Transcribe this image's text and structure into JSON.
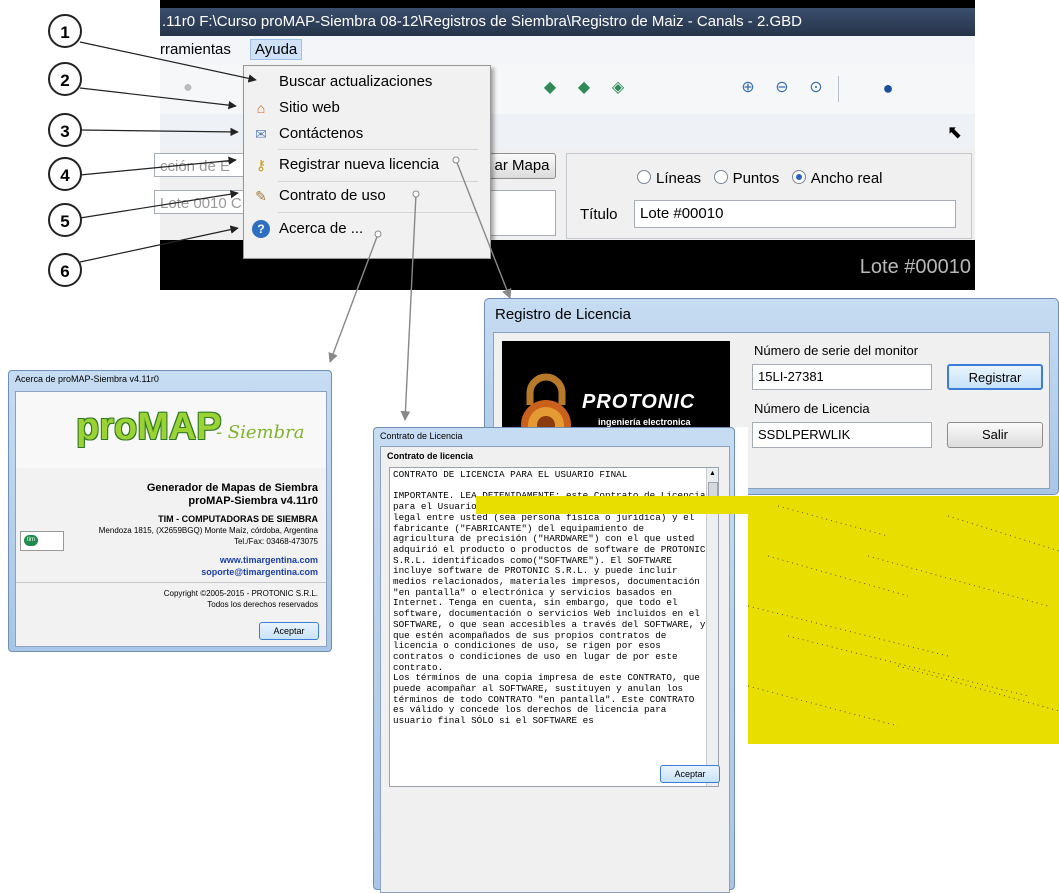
{
  "app": {
    "title": ".11r0   F:\\Curso proMAP-Siembra 08-12\\Registros de Siembra\\Registro de Maiz - Canals - 2.GBD",
    "menus": [
      "rramientas",
      "Ayuda"
    ],
    "panel": {
      "selection_placeholder": "cción de E",
      "lot_value": "Lote 0010 C",
      "show_map_button": "ar Mapa",
      "radios": [
        {
          "label": "Líneas",
          "checked": false
        },
        {
          "label": "Puntos",
          "checked": false
        },
        {
          "label": "Ancho real",
          "checked": true
        }
      ],
      "title_label": "Título",
      "title_value": "Lote #00010"
    },
    "map_title": "Lote #00010"
  },
  "help_menu": {
    "items": [
      {
        "label": "Buscar actualizaciones",
        "icon": "none"
      },
      {
        "label": "Sitio web",
        "icon": "house-globe-icon"
      },
      {
        "label": "Contáctenos",
        "icon": "envelope-icon"
      },
      {
        "label": "Registrar nueva licencia",
        "icon": "key-icon"
      },
      {
        "label": "Contrato de uso",
        "icon": "document-icon"
      },
      {
        "label": "Acerca de ...",
        "icon": "help-icon"
      }
    ]
  },
  "callouts": [
    "1",
    "2",
    "3",
    "4",
    "5",
    "6"
  ],
  "registro": {
    "window_title": "Registro de Licencia",
    "brand": "PROTONIC",
    "brand_sub": "ingeniería electronica",
    "serial_label": "Número de serie del monitor",
    "serial_value": "15LI-27381",
    "license_label": "Número de Licencia",
    "license_value": "SSDLPERWLIK",
    "register_button": "Registrar",
    "exit_button": "Salir"
  },
  "acerca": {
    "window_title": "Acerca de proMAP-Siembra v4.11r0",
    "logo_main": "proMAP",
    "logo_sub": "- Siembra",
    "line1": "Generador de Mapas de Siembra",
    "line2": "proMAP-Siembra v4.11r0",
    "company": "TIM - COMPUTADORAS DE SIEMBRA",
    "address": "Mendoza 1815, (X2659BGQ) Monte Maíz, córdoba, Argentina",
    "phone": "Tel./Fax: 03468-473075",
    "web": "www.timargentina.com",
    "email": "soporte@timargentina.com",
    "copyright": "Copyright ©2005-2015 - PROTONIC S.R.L.",
    "rights": "Todos los derechos reservados",
    "accept_button": "Aceptar",
    "tim_logo": "tim"
  },
  "contrato": {
    "window_title": "Contrato de Licencia",
    "heading": "Contrato de licencia",
    "text": "CONTRATO DE LICENCIA PARA EL USUARIO FINAL\n\nIMPORTANTE. LEA DETENIDAMENTE: este Contrato de Licencia para el Usuario Final (\"CONTRATO\") constituye un acuerdo legal entre usted (sea persona física o jurídica) y el fabricante (\"FABRICANTE\") del equipamiento de agricultura de precisión (\"HARDWARE\") con el que usted adquirió el producto o productos de software de PROTONIC S.R.L. identificados como(\"SOFTWARE\"). El SOFTWARE incluye software de PROTONIC S.R.L. y puede incluir medios relacionados, materiales impresos, documentación \"en pantalla\" o electrónica y servicios basados en Internet. Tenga en cuenta, sin embargo, que todo el software, documentación o servicios Web incluidos en el SOFTWARE, o que sean accesibles a través del SOFTWARE, y que estén acompañados de sus propios contratos de licencia o condiciones de uso, se rigen por esos contratos o condiciones de uso en lugar de por este contrato.\nLos términos de una copia impresa de este CONTRATO, que puede acompañar al SOFTWARE, sustituyen y anulan los términos de todo CONTRATO \"en pantalla\". Este CONTRATO es válido y concede los derechos de licencia para usuario final SÓLO si el SOFTWARE es",
    "accept_button": "Aceptar"
  }
}
